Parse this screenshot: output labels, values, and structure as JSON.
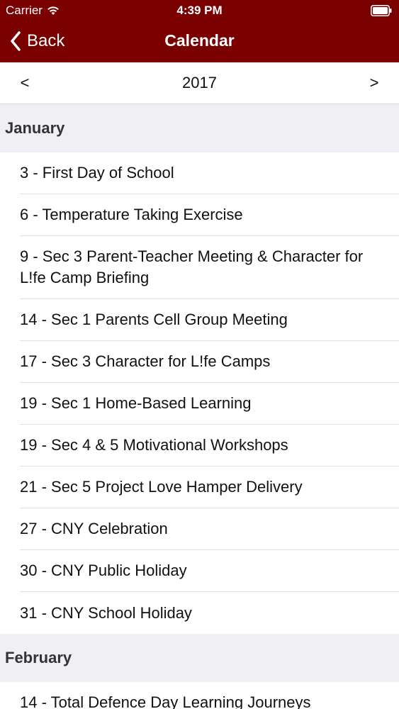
{
  "status_bar": {
    "carrier": "Carrier",
    "time": "4:39 PM"
  },
  "nav": {
    "back_label": "Back",
    "title": "Calendar"
  },
  "year_selector": {
    "prev": "<",
    "year": "2017",
    "next": ">"
  },
  "sections": [
    {
      "month": "January",
      "events": [
        "3 - First Day of School",
        "6 - Temperature Taking Exercise",
        "9 - Sec 3 Parent-Teacher Meeting & Character for L!fe Camp Briefing",
        "14 - Sec 1 Parents Cell Group Meeting",
        "17 - Sec 3 Character for L!fe Camps",
        "19 - Sec 1 Home-Based Learning",
        "19 - Sec 4 & 5 Motivational Workshops",
        "21 - Sec 5 Project Love Hamper Delivery",
        "27 - CNY Celebration",
        "30 - CNY Public Holiday",
        "31 - CNY School Holiday"
      ]
    },
    {
      "month": "February",
      "events": [
        "14 - Total Defence Day Learning Journeys"
      ]
    }
  ],
  "colors": {
    "nav_background": "#7a0000",
    "section_background": "#efeff4"
  }
}
